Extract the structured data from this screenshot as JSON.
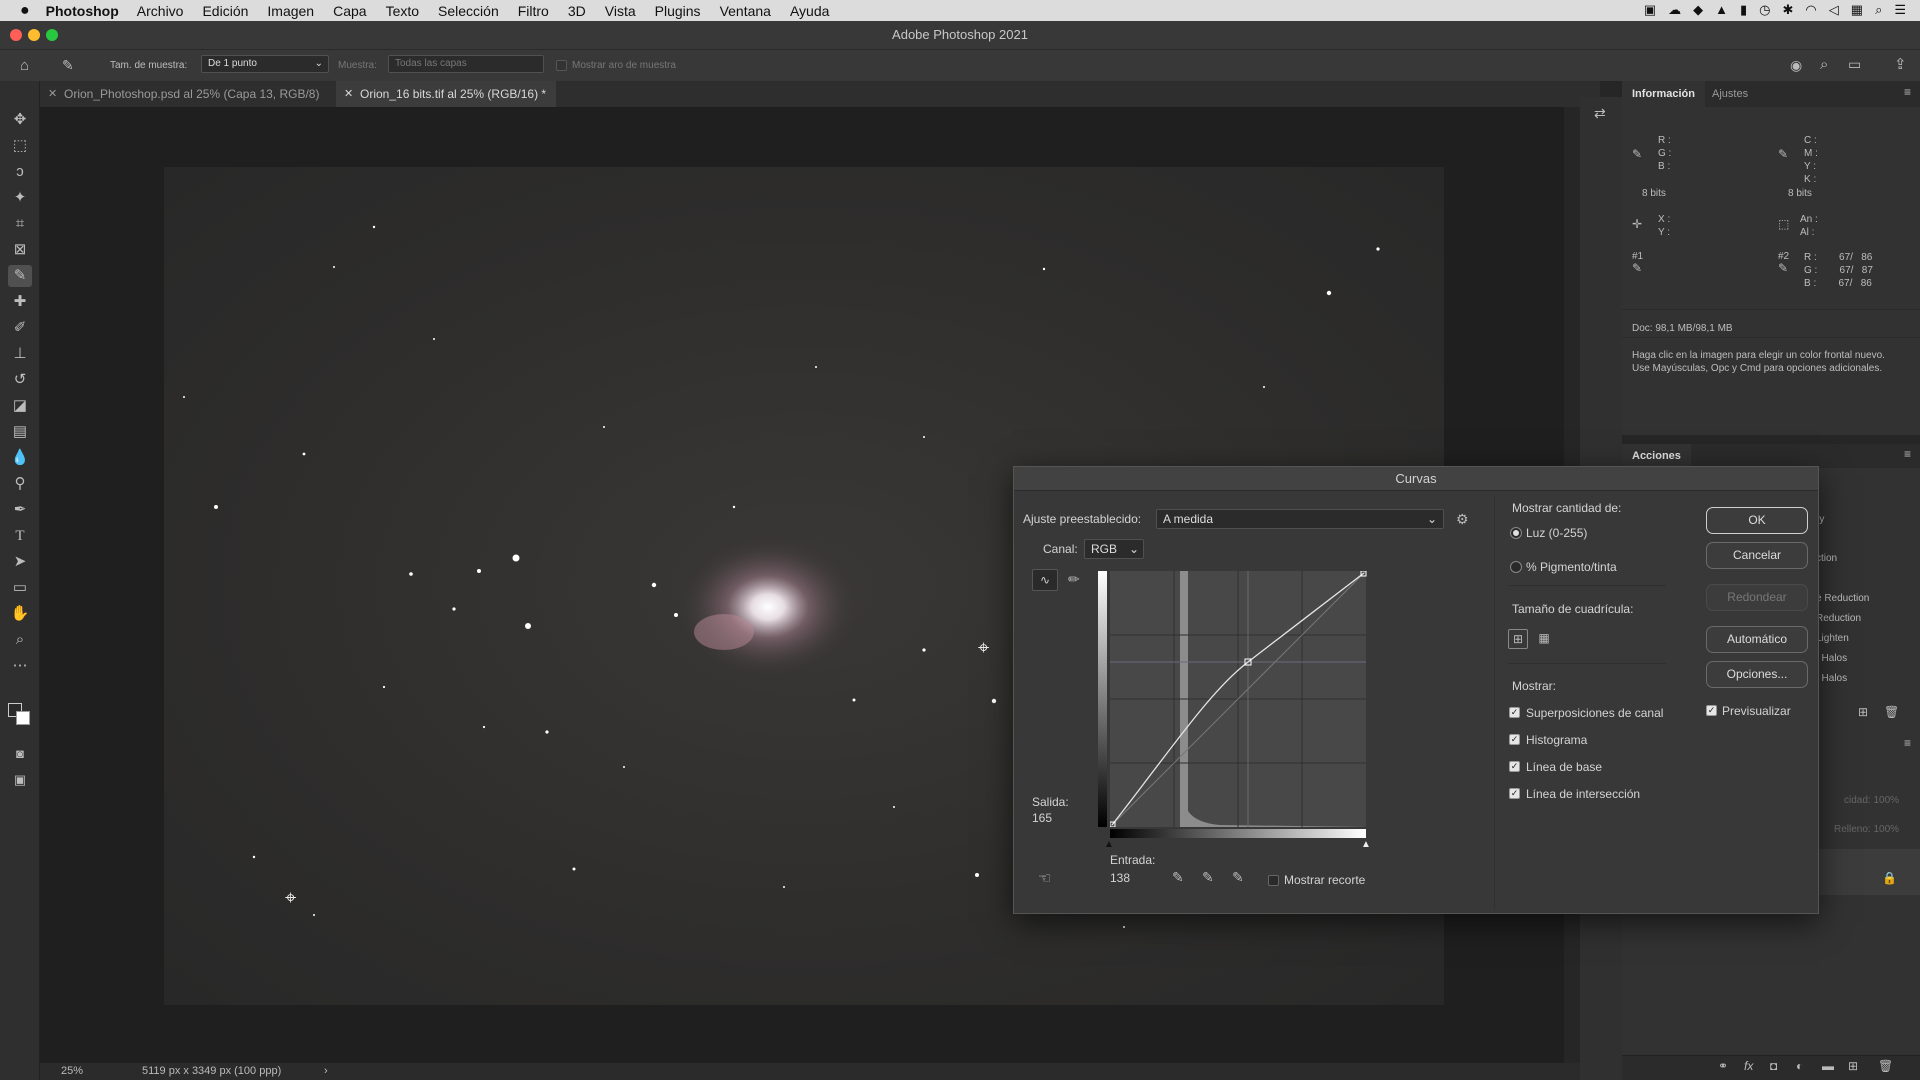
{
  "menubar": {
    "apple": "",
    "app": "Photoshop",
    "items": [
      "Archivo",
      "Edición",
      "Imagen",
      "Capa",
      "Texto",
      "Selección",
      "Filtro",
      "3D",
      "Vista",
      "Plugins",
      "Ventana",
      "Ayuda"
    ]
  },
  "window": {
    "title": "Adobe Photoshop 2021"
  },
  "options": {
    "sample_size_label": "Tam. de muestra:",
    "sample_size_value": "De 1 punto",
    "sample_label": "Muestra:",
    "sample_value": "Todas las capas",
    "show_ring_label": "Mostrar aro de muestra"
  },
  "tabs": [
    {
      "label": "Orion_Photoshop.psd al 25% (Capa 13, RGB/8)"
    },
    {
      "label": "Orion_16 bits.tif al 25% (RGB/16) *"
    }
  ],
  "status": {
    "zoom": "25%",
    "doc_size": "5119 px x 3349 px (100 ppp)",
    "arrow": "›"
  },
  "info_panel": {
    "tab_info": "Información",
    "tab_adjust": "Ajustes",
    "rgb_labels": "R :\nG :\nB :",
    "cmyk_labels": "C :\nM :\nY :\nK :",
    "bits_left": "8 bits",
    "bits_right": "8 bits",
    "xy_labels": "X :\nY :",
    "wh_labels": "An :\nAl :",
    "sampler1": "#1",
    "sampler2": "#2",
    "sampler2_values": "R :        67/   86\nG :        67/   87\nB :        67/   86",
    "doc": "Doc: 98,1 MB/98,1 MB",
    "hint": "Haga clic en la imagen para elegir un color frontal nuevo. Use Mayúsculas, Opc y Cmd para opciones adicionales."
  },
  "actions_panel": {
    "title": "Acciones",
    "items": [
      "ry",
      "ction",
      "e Reduction",
      "Reduction",
      "Lighten",
      "t Halos",
      "t Halos"
    ],
    "opacity": "cidad: 100%",
    "fill": "Relleno: 100%"
  },
  "curves": {
    "title": "Curvas",
    "preset_label": "Ajuste preestablecido:",
    "preset_value": "A medida",
    "channel_label": "Canal:",
    "channel_value": "RGB",
    "output_label": "Salida:",
    "output_value": "165",
    "input_label": "Entrada:",
    "input_value": "138",
    "show_clipping": "Mostrar recorte",
    "show_amount_label": "Mostrar cantidad de:",
    "light": "Luz (0-255)",
    "pigment": "% Pigmento/tinta",
    "grid_size": "Tamaño de cuadrícula:",
    "show_label": "Mostrar:",
    "channel_overlays": "Superposiciones de canal",
    "histogram": "Histograma",
    "baseline": "Línea de base",
    "intersection": "Línea de intersección",
    "ok": "OK",
    "cancel": "Cancelar",
    "smooth": "Redondear",
    "auto": "Automático",
    "options": "Opciones...",
    "preview": "Previsualizar"
  }
}
